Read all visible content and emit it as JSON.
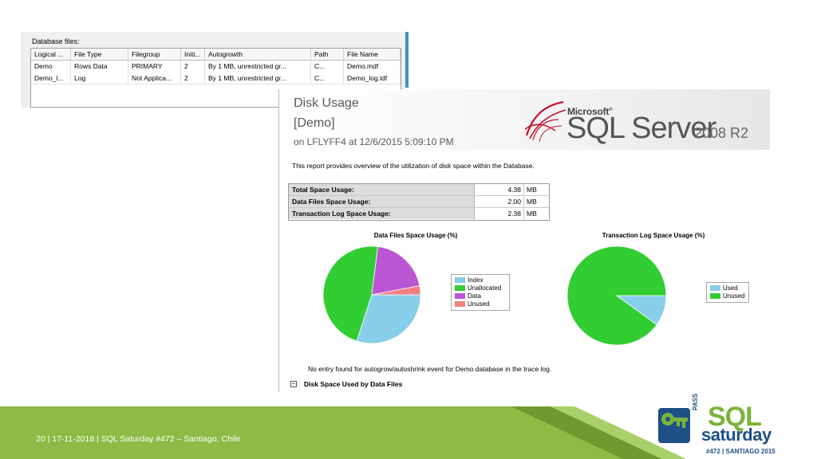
{
  "files_panel": {
    "title": "Database files:",
    "columns": [
      "Logical ...",
      "File Type",
      "Filegroup",
      "Initi...",
      "Autogrowth",
      "Path",
      "File Name"
    ],
    "rows": [
      {
        "logical": "Demo",
        "type": "Rows Data",
        "filegroup": "PRIMARY",
        "initial": "2",
        "autogrowth": "By 1 MB, unrestricted gr...",
        "button": "...",
        "path": "C...",
        "file": "Demo.mdf"
      },
      {
        "logical": "Demo_l...",
        "type": "Log",
        "filegroup": "Not Applica...",
        "initial": "2",
        "autogrowth": "By 1 MB, unrestricted gr...",
        "button": "...",
        "path": "C...",
        "file": "Demo_log.ldf"
      }
    ]
  },
  "report": {
    "title": "Disk Usage",
    "database": "[Demo]",
    "server_line": "on LFLYFF4 at 12/6/2015 5:09:10 PM",
    "logo": {
      "microsoft": "Microsoft",
      "product": "SQL Server",
      "version": "2008 R2"
    },
    "description": "This report provides overview of the utilization of disk space within the Database.",
    "usage": [
      {
        "label": "Total Space Usage:",
        "value": "4.38",
        "unit": "MB"
      },
      {
        "label": "Data Files Space Usage:",
        "value": "2.00",
        "unit": "MB"
      },
      {
        "label": "Transaction Log Space Usage:",
        "value": "2.38",
        "unit": "MB"
      }
    ],
    "trace_message": "No entry found for autogrow/autoshrink event for Demo database in the trace log.",
    "section_toggle": "−",
    "section_label": "Disk Space Used by Data Files"
  },
  "chart_data": [
    {
      "type": "pie",
      "title": "Data Files Space Usage (%)",
      "categories": [
        "Index",
        "Unallocated",
        "Data",
        "Unused"
      ],
      "values": [
        30,
        47,
        20,
        3
      ],
      "colors": [
        "#87ceeb",
        "#32cd32",
        "#ba55d3",
        "#f08080"
      ],
      "legend": "right"
    },
    {
      "type": "pie",
      "title": "Transaction Log Space Usage (%)",
      "categories": [
        "Used",
        "Unused"
      ],
      "values": [
        10,
        90
      ],
      "colors": [
        "#87ceeb",
        "#32cd32"
      ],
      "legend": "right"
    }
  ],
  "footer": {
    "slide_info": "20  |  17-11-2018  |    SQL Saturday #472 – Santiago, Chile",
    "logo": {
      "pass": "PASS",
      "sql": "SQL",
      "saturday": "saturday",
      "event": "#472 | SANTIAGO 2015"
    }
  },
  "theme": {
    "footer_green": "#8dbb45",
    "footer_dark": "#6f9a30",
    "brand_blue": "#1e4f86",
    "brand_green": "#79b43a"
  }
}
